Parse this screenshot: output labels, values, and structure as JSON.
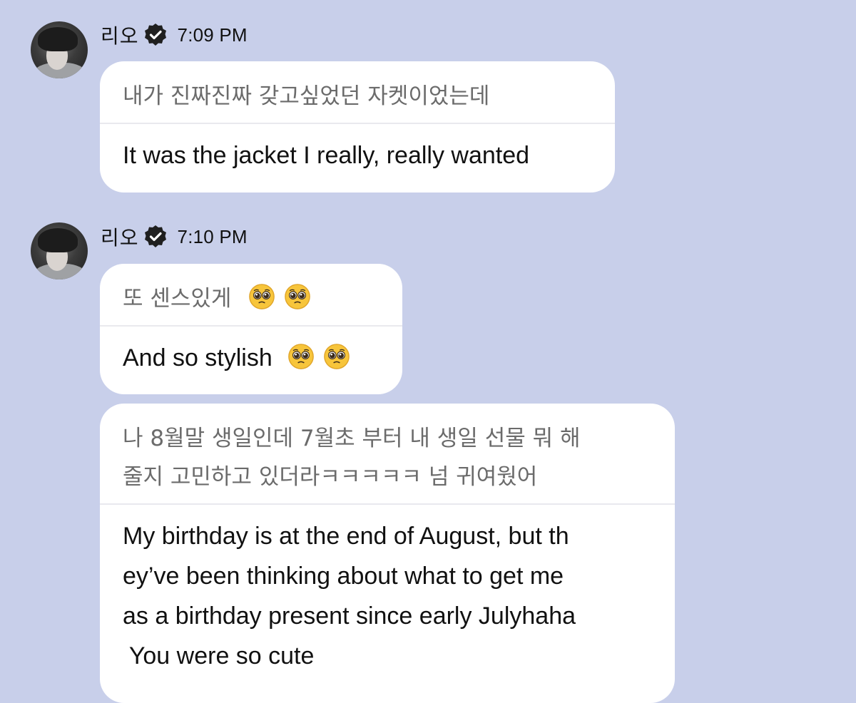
{
  "messages": [
    {
      "sender": "리오",
      "time": "7:09 PM",
      "korean": "내가 진짜진짜 갖고싶었던 자켓이었는데",
      "english": "It was the jacket I really, really wanted"
    },
    {
      "sender": "리오",
      "time": "7:10 PM",
      "korean": "또 센스있게",
      "english": "And so stylish",
      "emoji": "pleading-face-emoji"
    },
    {
      "korean": "나 8월말 생일인데 7월초 부터 내 생일 선물 뭐 해 줄지 고민하고 있더라ㅋㅋㅋㅋㅋ 넘 귀여웠어",
      "korean_line1": "나 8월말 생일인데 7월초 부터 내 생일 선물 뭐 해",
      "korean_line2": "줄지 고민하고 있더라ㅋㅋㅋㅋㅋ 넘 귀여웠어",
      "english_line1": "My birthday is at the end of August, but th",
      "english_line2": "ey’ve been thinking about what to get me",
      "english_line3": "as a birthday present since early Julyhaha",
      "english_line4": " You were so cute"
    }
  ],
  "icons": {
    "verified": "verified-badge-icon",
    "avatar": "profile-avatar"
  },
  "colors": {
    "background": "#c8cfea",
    "bubble": "#ffffff",
    "korean_text": "#6b6b6b",
    "english_text": "#111111"
  }
}
